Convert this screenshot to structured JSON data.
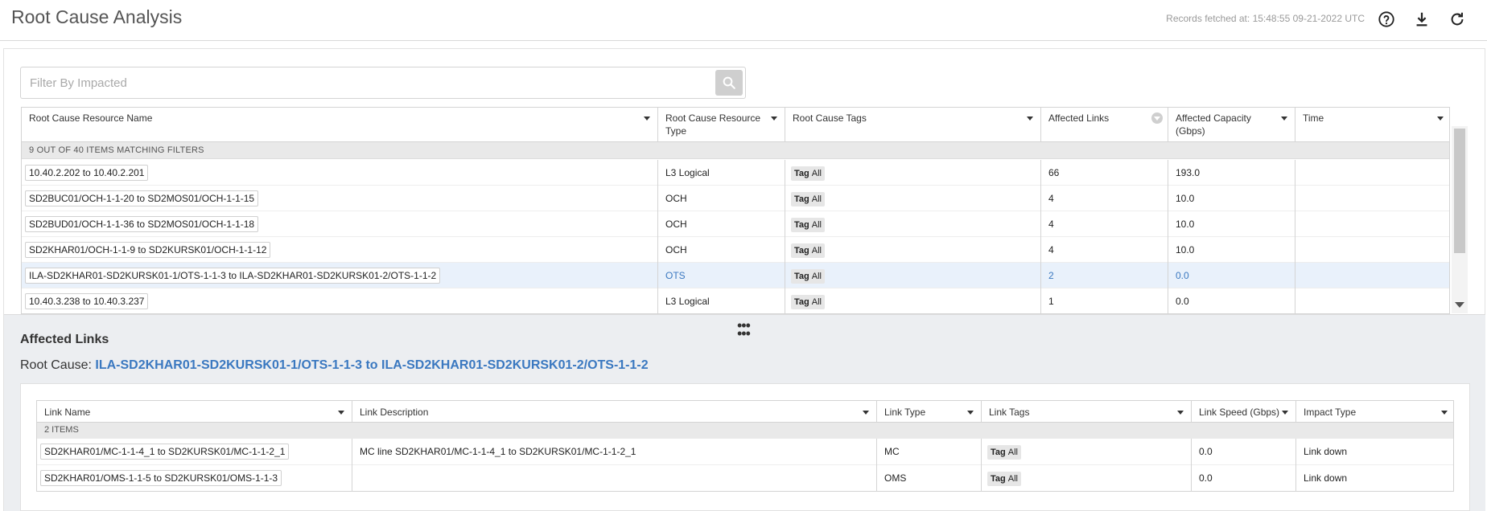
{
  "header": {
    "title": "Root Cause Analysis",
    "records_fetched": "Records fetched at: 15:48:55 09-21-2022 UTC",
    "icons": [
      "help-icon",
      "download-icon",
      "refresh-icon"
    ]
  },
  "filter": {
    "placeholder": "Filter By Impacted",
    "value": ""
  },
  "root_table": {
    "columns": [
      "Root Cause Resource Name",
      "Root Cause Resource Type",
      "Root Cause Tags",
      "Affected Links",
      "Affected Capacity (Gbps)",
      "Time"
    ],
    "group_label": "9 OUT OF 40 ITEMS MATCHING FILTERS",
    "rows": [
      {
        "name": "10.40.2.202 to 10.40.2.201",
        "type": "L3 Logical",
        "tag": "Tag",
        "tag_value": "All",
        "links": "66",
        "capacity": "193.0",
        "time": ""
      },
      {
        "name": "SD2BUC01/OCH-1-1-20 to SD2MOS01/OCH-1-1-15",
        "type": "OCH",
        "tag": "Tag",
        "tag_value": "All",
        "links": "4",
        "capacity": "10.0",
        "time": ""
      },
      {
        "name": "SD2BUD01/OCH-1-1-36 to SD2MOS01/OCH-1-1-18",
        "type": "OCH",
        "tag": "Tag",
        "tag_value": "All",
        "links": "4",
        "capacity": "10.0",
        "time": ""
      },
      {
        "name": "SD2KHAR01/OCH-1-1-9 to SD2KURSK01/OCH-1-1-12",
        "type": "OCH",
        "tag": "Tag",
        "tag_value": "All",
        "links": "4",
        "capacity": "10.0",
        "time": ""
      },
      {
        "name": "ILA-SD2KHAR01-SD2KURSK01-1/OTS-1-1-3 to ILA-SD2KHAR01-SD2KURSK01-2/OTS-1-1-2",
        "type": "OTS",
        "tag": "Tag",
        "tag_value": "All",
        "links": "2",
        "capacity": "0.0",
        "time": ""
      },
      {
        "name": "10.40.3.238 to 10.40.3.237",
        "type": "L3 Logical",
        "tag": "Tag",
        "tag_value": "All",
        "links": "1",
        "capacity": "0.0",
        "time": ""
      }
    ]
  },
  "affected": {
    "title": "Affected Links",
    "root_cause_label": "Root Cause:",
    "root_cause_value": "ILA-SD2KHAR01-SD2KURSK01-1/OTS-1-1-3 to ILA-SD2KHAR01-SD2KURSK01-2/OTS-1-1-2",
    "columns": [
      "Link Name",
      "Link Description",
      "Link Type",
      "Link Tags",
      "Link Speed (Gbps)",
      "Impact Type"
    ],
    "group_label": "2 ITEMS",
    "rows": [
      {
        "name": "SD2KHAR01/MC-1-1-4_1 to SD2KURSK01/MC-1-1-2_1",
        "description": "MC line SD2KHAR01/MC-1-1-4_1 to SD2KURSK01/MC-1-1-2_1",
        "type": "MC",
        "tag": "Tag",
        "tag_value": "All",
        "speed": "0.0",
        "impact": "Link down"
      },
      {
        "name": "SD2KHAR01/OMS-1-1-5 to SD2KURSK01/OMS-1-1-3",
        "description": "",
        "type": "OMS",
        "tag": "Tag",
        "tag_value": "All",
        "speed": "0.0",
        "impact": "Link down"
      }
    ]
  },
  "colors": {
    "accent": "#3a78c0",
    "selected_row": "#e9f1fb",
    "green": "#6bbf3a"
  }
}
